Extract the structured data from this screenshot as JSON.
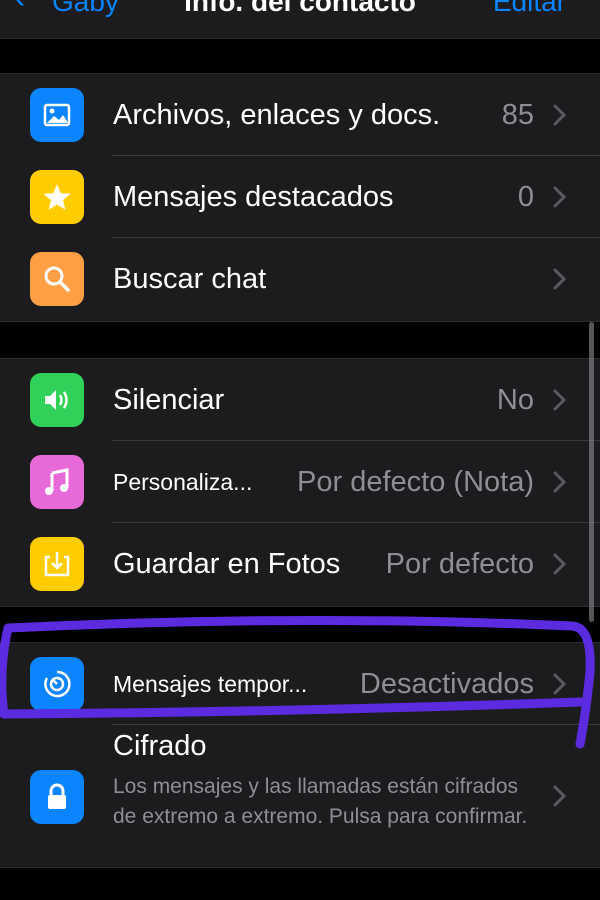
{
  "nav": {
    "back_label": "Gaby",
    "title": "Info. del contacto",
    "edit_label": "Editar"
  },
  "group1": [
    {
      "label": "Archivos, enlaces y docs.",
      "value": "85",
      "icon": "photo-icon",
      "color": "#0a84ff"
    },
    {
      "label": "Mensajes destacados",
      "value": "0",
      "icon": "star-icon",
      "color": "#ffcc00"
    },
    {
      "label": "Buscar chat",
      "value": "",
      "icon": "search-icon",
      "color": "#ff9f45"
    }
  ],
  "group2": [
    {
      "label": "Silenciar",
      "value": "No",
      "icon": "speaker-icon",
      "color": "#30d158"
    },
    {
      "label": "Personaliza...",
      "value": "Por defecto (Nota)",
      "icon": "music-note-icon",
      "color": "#e86ad8"
    },
    {
      "label": "Guardar en Fotos",
      "value": "Por defecto",
      "icon": "save-download-icon",
      "color": "#ffcc00"
    }
  ],
  "group3": {
    "temp": {
      "label": "Mensajes tempor...",
      "value": "Desactivados",
      "icon": "timer-icon",
      "color": "#0a84ff"
    },
    "cipher": {
      "title": "Cifrado",
      "description": "Los mensajes y las llamadas están cifrados de extremo a extremo. Pulsa para confirmar.",
      "icon": "lock-icon",
      "color": "#0a84ff"
    }
  },
  "annotation": {
    "color": "#5b2be0"
  }
}
